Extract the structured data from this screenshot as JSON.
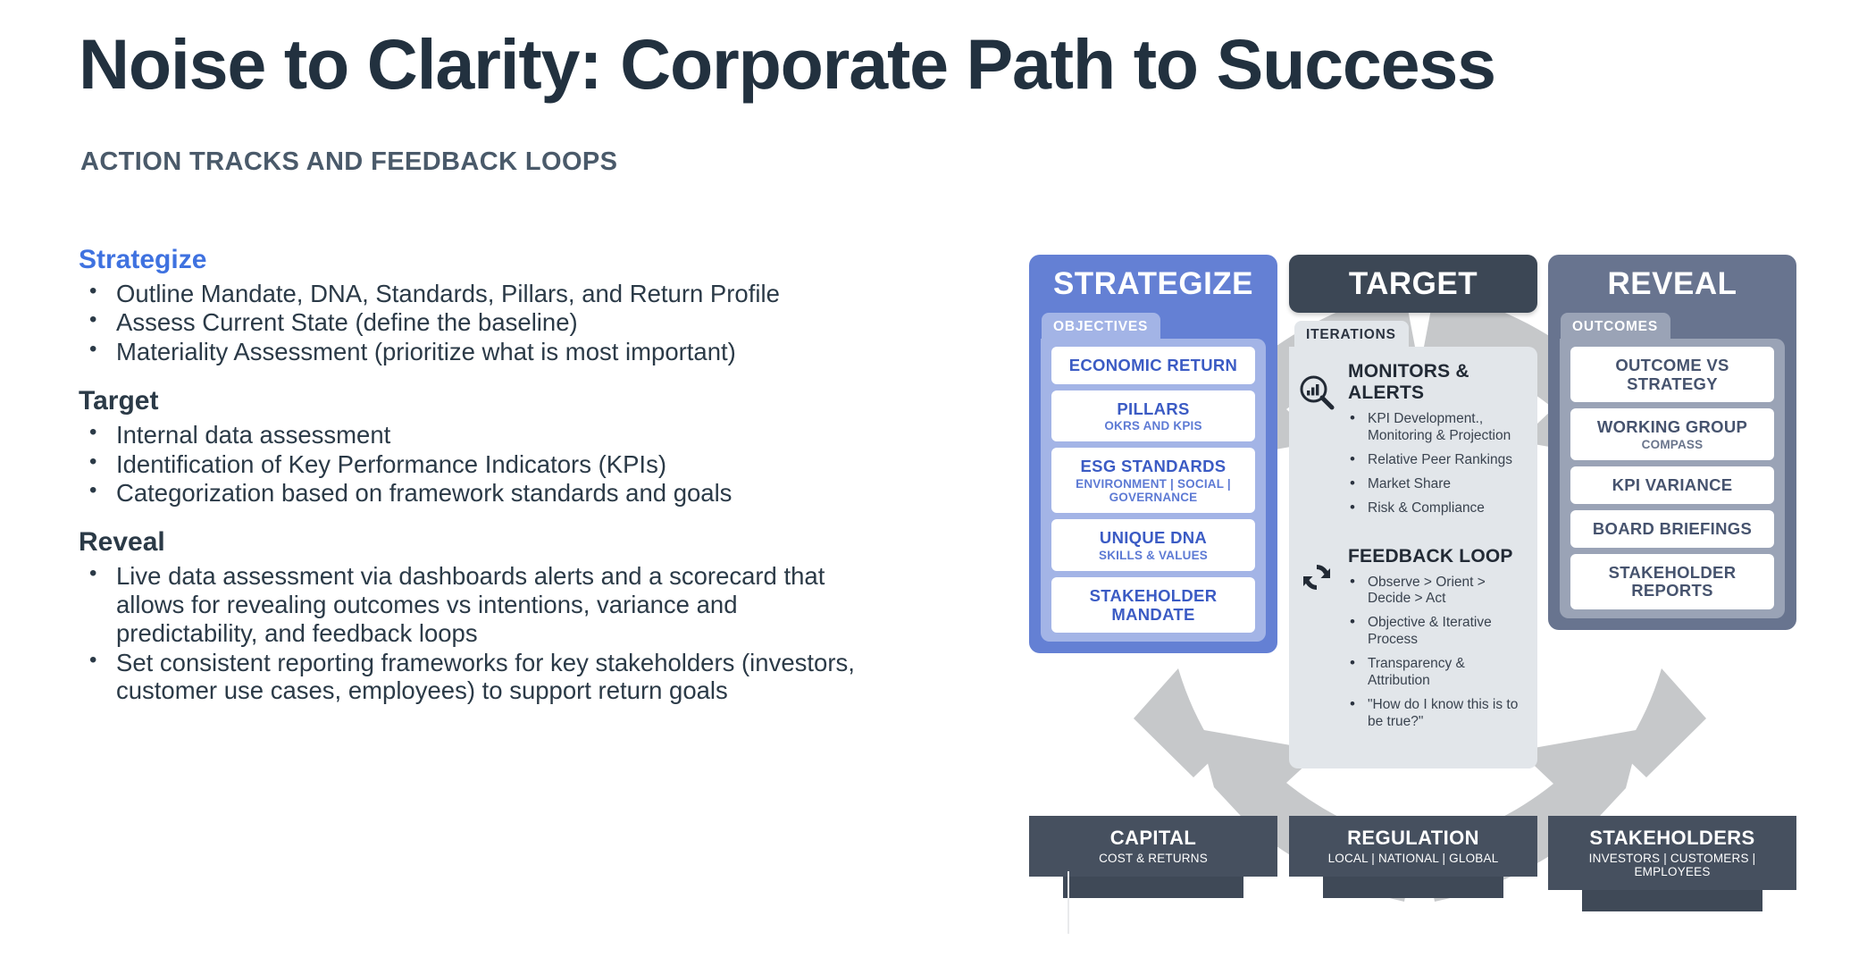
{
  "header": {
    "title": "Noise to Clarity: Corporate Path to Success",
    "subtitle": "ACTION TRACKS AND FEEDBACK LOOPS"
  },
  "colors": {
    "title": "#22313f",
    "subtitle": "#4a5a6a",
    "accent_blue": "#3f72e0",
    "strategize": "#6480d4",
    "target": "#3c4755",
    "reveal": "#68748f",
    "footer": "#46505f",
    "ring_gray": "#c6c8ca"
  },
  "sections": [
    {
      "heading": "Strategize",
      "accent": true,
      "bullets": [
        "Outline Mandate, DNA, Standards, Pillars, and Return Profile",
        "Assess Current State (define the baseline)",
        "Materiality Assessment (prioritize what is most important)"
      ]
    },
    {
      "heading": "Target",
      "accent": false,
      "bullets": [
        "Internal data assessment",
        "Identification of Key Performance Indicators (KPIs)",
        "Categorization based on framework standards and goals"
      ]
    },
    {
      "heading": "Reveal",
      "accent": false,
      "bullets": [
        "Live data assessment via dashboards alerts and a scorecard that allows for revealing outcomes vs intentions, variance and predictability, and feedback loops",
        "Set consistent reporting frameworks for key stakeholders (investors, customer use cases, employees) to support return goals"
      ]
    }
  ],
  "diagram": {
    "strategize": {
      "header": "STRATEGIZE",
      "tab": "OBJECTIVES",
      "chips": [
        {
          "title": "ECONOMIC RETURN",
          "sub": ""
        },
        {
          "title": "PILLARS",
          "sub": "OKRS AND KPIS"
        },
        {
          "title": "ESG STANDARDS",
          "sub": "ENVIRONMENT | SOCIAL | GOVERNANCE"
        },
        {
          "title": "UNIQUE DNA",
          "sub": "SKILLS & VALUES"
        },
        {
          "title": "STAKEHOLDER MANDATE",
          "sub": ""
        }
      ]
    },
    "target": {
      "header": "TARGET",
      "tab": "ITERATIONS",
      "groups": [
        {
          "icon": "magnifier-chart-icon",
          "title": "MONITORS & ALERTS",
          "items": [
            "KPI Development., Monitoring & Projection",
            "Relative Peer Rankings",
            "Market Share",
            "Risk & Compliance"
          ]
        },
        {
          "icon": "refresh-loop-icon",
          "title": "FEEDBACK LOOP",
          "items": [
            "Observe > Orient > Decide > Act",
            "Objective & Iterative Process",
            "Transparency & Attribution",
            "\"How do I know this is to be true?\""
          ]
        }
      ]
    },
    "reveal": {
      "header": "REVEAL",
      "tab": "OUTCOMES",
      "chips": [
        {
          "title": "OUTCOME VS STRATEGY",
          "sub": ""
        },
        {
          "title": "WORKING GROUP",
          "sub": "COMPASS"
        },
        {
          "title": "KPI VARIANCE",
          "sub": ""
        },
        {
          "title": "BOARD BRIEFINGS",
          "sub": ""
        },
        {
          "title": "STAKEHOLDER REPORTS",
          "sub": ""
        }
      ]
    },
    "footer_cards": [
      {
        "title": "CAPITAL",
        "sub": "COST & RETURNS"
      },
      {
        "title": "REGULATION",
        "sub": "LOCAL | NATIONAL | GLOBAL"
      },
      {
        "title": "STAKEHOLDERS",
        "sub": "INVESTORS | CUSTOMERS | EMPLOYEES"
      }
    ]
  }
}
